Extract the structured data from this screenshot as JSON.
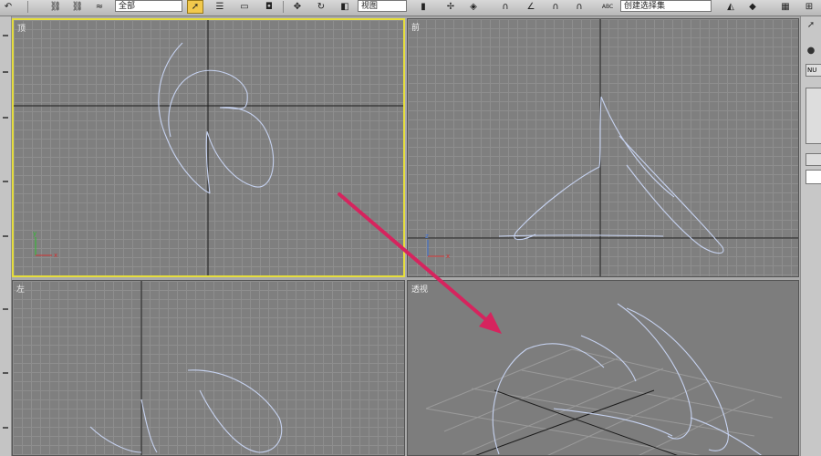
{
  "toolbar": {
    "selection_filter": "全部",
    "reference_coord": "视图",
    "named_selection": "创建选择集",
    "abc_label": "ABC"
  },
  "viewports": {
    "top": {
      "label": "顶"
    },
    "front": {
      "label": "前"
    },
    "left": {
      "label": "左"
    },
    "perspective": {
      "label": "透视"
    }
  },
  "gizmo": {
    "x": "x",
    "y": "y",
    "z": "z"
  },
  "right_panel": {
    "field_text": "NU"
  },
  "colors": {
    "viewport_bg": "#7f7f7f",
    "active_border": "#e6de3c",
    "spline": "#c6d2f0",
    "annotation_arrow": "#d6245e"
  }
}
